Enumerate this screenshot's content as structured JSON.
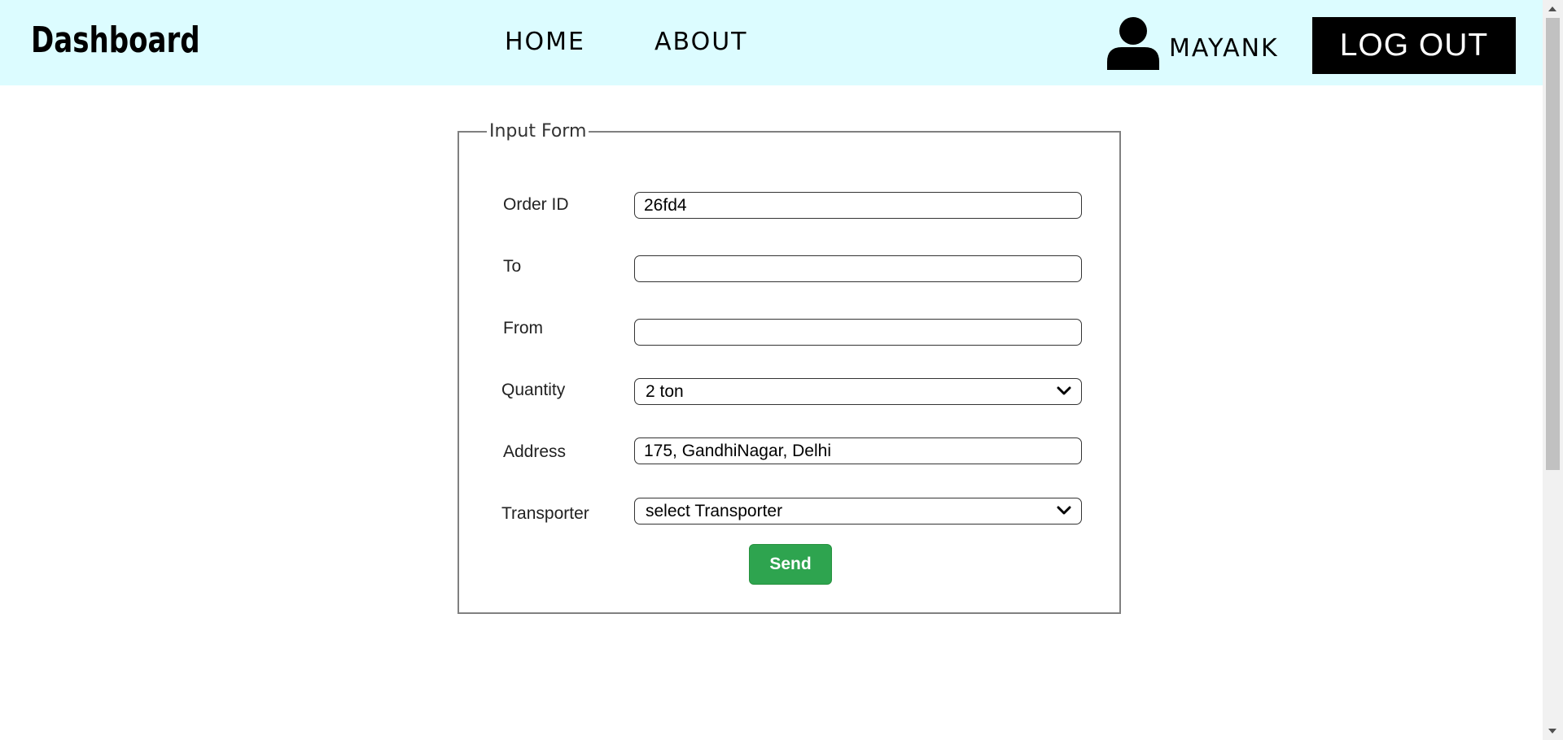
{
  "header": {
    "brand": "Dashboard",
    "nav": [
      {
        "label": "HOME"
      },
      {
        "label": "ABOUT"
      }
    ],
    "user": {
      "icon": "user-icon",
      "name": "MAYANK"
    },
    "logout_label": "LOG OUT",
    "background_color": "#dcfcff"
  },
  "form": {
    "legend": "Input Form",
    "fields": {
      "order_id": {
        "label": "Order ID",
        "value": "26fd4"
      },
      "to": {
        "label": "To",
        "value": ""
      },
      "from": {
        "label": "From",
        "value": ""
      },
      "quantity": {
        "label": "Quantity",
        "selected": "2 ton"
      },
      "address": {
        "label": "Address",
        "value": "175, GandhiNagar, Delhi"
      },
      "transporter": {
        "label": "Transporter",
        "selected": "select Transporter"
      }
    },
    "send_label": "Send",
    "send_color": "#2ea44f"
  }
}
